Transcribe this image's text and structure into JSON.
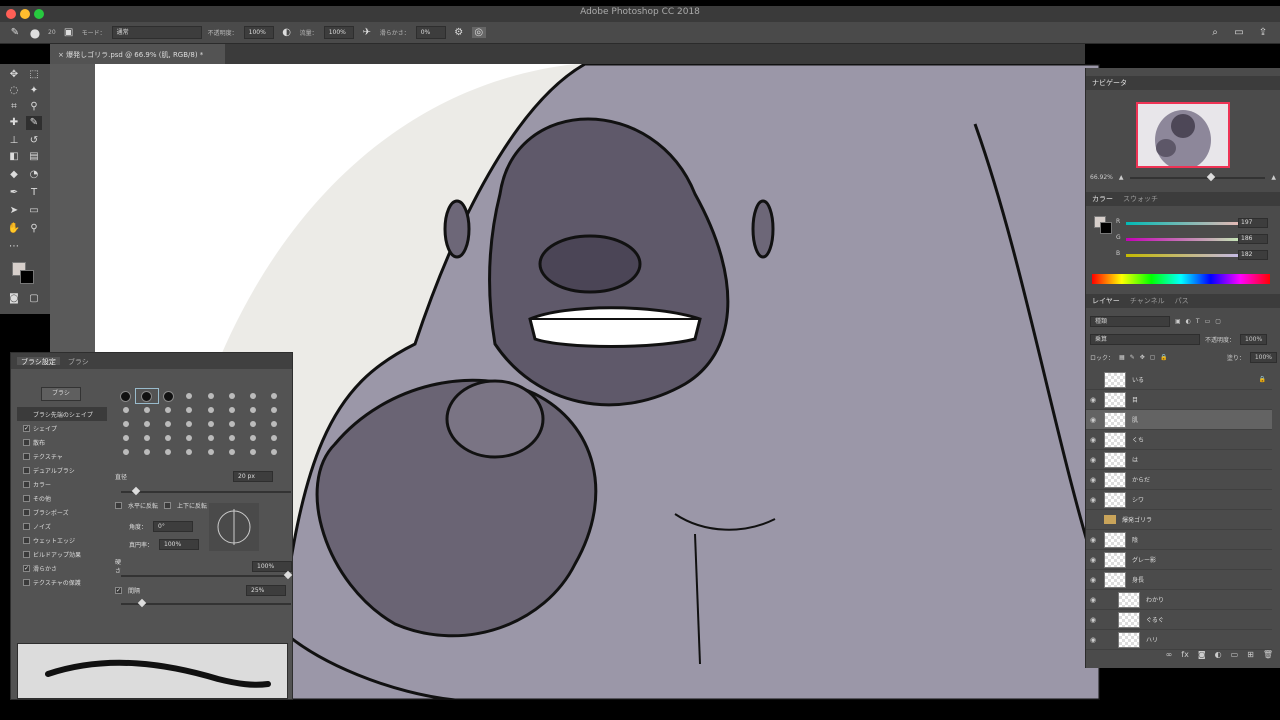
{
  "app": {
    "title": "Adobe Photoshop CC 2018",
    "colors": {
      "chrome": "#4a4a4a",
      "accent_close": "#ff5f56",
      "accent_min": "#ffbd2e",
      "accent_max": "#27c93f",
      "nav_frame": "#e33355"
    }
  },
  "options": {
    "brush_size": "20",
    "mode_label": "モード：",
    "mode_value": "通常",
    "opacity_label": "不透明度：",
    "opacity_value": "100%",
    "flow_label": "流量：",
    "flow_value": "100%",
    "smoothing_label": "滑らかさ：",
    "smoothing_value": "0%"
  },
  "document": {
    "tab_title": "爆発しゴリラ.psd @ 66.9% (肌, RGB/8) *"
  },
  "brush_panel": {
    "tabs": [
      "ブラシ設定",
      "ブラシ"
    ],
    "preset_button": "ブラシ",
    "options": [
      {
        "label": "ブラシ先端のシェイプ",
        "checked": false,
        "selected": true
      },
      {
        "label": "シェイプ",
        "checked": true
      },
      {
        "label": "散布",
        "checked": false
      },
      {
        "label": "テクスチャ",
        "checked": false
      },
      {
        "label": "デュアルブラシ",
        "checked": false
      },
      {
        "label": "カラー",
        "checked": false
      },
      {
        "label": "その他",
        "checked": false
      },
      {
        "label": "ブラシポーズ",
        "checked": false
      },
      {
        "label": "ノイズ",
        "checked": false
      },
      {
        "label": "ウェットエッジ",
        "checked": false
      },
      {
        "label": "ビルドアップ効果",
        "checked": false
      },
      {
        "label": "滑らかさ",
        "checked": true
      },
      {
        "label": "テクスチャの保護",
        "checked": false
      }
    ],
    "tip_sizes": [
      "30",
      "30",
      "30",
      "25",
      "25",
      "25",
      "36",
      "25",
      "36",
      "36",
      "36",
      "32",
      "25",
      "50",
      "25",
      "25",
      "50",
      "71",
      "25",
      "50",
      "50",
      "50",
      "50",
      "50",
      "25",
      "25",
      "20",
      "20",
      "20",
      "20",
      "20",
      "20",
      "50",
      "50",
      "50",
      "50",
      "70",
      "50",
      "50",
      "50"
    ],
    "size_label": "直径",
    "size_value": "20 px",
    "flip_x_label": "水平に反転",
    "flip_y_label": "上下に反転",
    "angle_label": "角度：",
    "angle_value": "0°",
    "roundness_label": "真円率：",
    "roundness_value": "100%",
    "hardness_label": "硬さ",
    "hardness_value": "100%",
    "spacing_label": "間隔",
    "spacing_value": "25%"
  },
  "navigator": {
    "tabs": [
      "ナビゲータ"
    ],
    "zoom_value": "66.92%"
  },
  "color_panel": {
    "tabs": [
      "カラー",
      "スウォッチ"
    ],
    "r_label": "R",
    "g_label": "G",
    "b_label": "B",
    "r_value": "197",
    "g_value": "186",
    "b_value": "182"
  },
  "layers_panel": {
    "tabs": [
      "レイヤー",
      "チャンネル",
      "パス"
    ],
    "filter_kind": "種類",
    "blend_mode": "乗算",
    "opacity_label": "不透明度：",
    "opacity_value": "100%",
    "lock_label": "ロック：",
    "fill_label": "塗り：",
    "fill_value": "100%",
    "layers": [
      {
        "name": "いる",
        "visible": false,
        "locked": true
      },
      {
        "name": "目",
        "visible": true
      },
      {
        "name": "肌",
        "visible": true,
        "selected": true
      },
      {
        "name": "くち",
        "visible": true
      },
      {
        "name": "は",
        "visible": true
      },
      {
        "name": "からだ",
        "visible": true
      },
      {
        "name": "シワ",
        "visible": true
      },
      {
        "name": "爆発ゴリラ",
        "visible": false,
        "folder": true
      },
      {
        "name": "陰",
        "visible": true
      },
      {
        "name": "グレー影",
        "visible": true
      },
      {
        "name": "身長",
        "visible": true
      },
      {
        "name": "わかり",
        "visible": true
      },
      {
        "name": "ぐるぐ",
        "visible": true
      },
      {
        "name": "ハリ",
        "visible": true
      }
    ]
  }
}
